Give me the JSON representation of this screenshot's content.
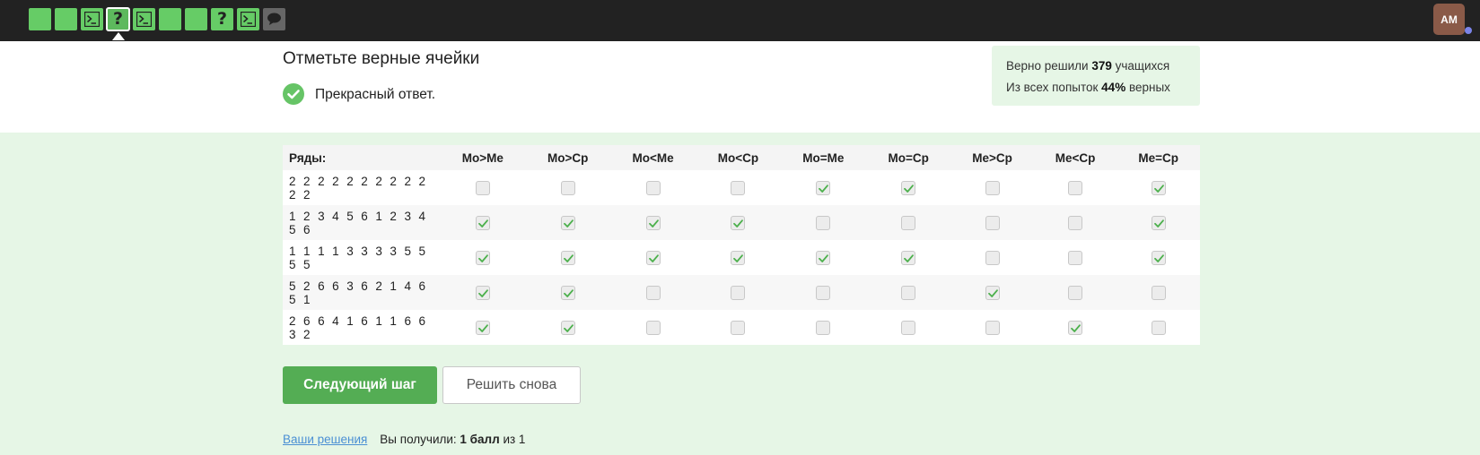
{
  "colors": {
    "accent": "#54ad54",
    "topbar": "#222222",
    "panel": "#e6f6e6",
    "link": "#4a8fd4"
  },
  "steps": [
    {
      "icon": "none",
      "state": "solved"
    },
    {
      "icon": "none",
      "state": "solved"
    },
    {
      "icon": "terminal-icon",
      "state": "solved"
    },
    {
      "icon": "question-icon",
      "glyph": "?",
      "state": "active"
    },
    {
      "icon": "terminal-icon",
      "state": "solved"
    },
    {
      "icon": "none",
      "state": "solved"
    },
    {
      "icon": "none",
      "state": "solved"
    },
    {
      "icon": "question-icon",
      "glyph": "?",
      "state": "solved"
    },
    {
      "icon": "terminal-icon",
      "state": "solved"
    },
    {
      "icon": "comment-icon",
      "state": "unsolved"
    }
  ],
  "user": {
    "initials": "АМ"
  },
  "task": {
    "title": "Отметьте верные ячейки",
    "feedback": "Прекрасный ответ."
  },
  "stats": {
    "solved_prefix": "Верно решили",
    "solved_count": "379",
    "solved_suffix": "учащихся",
    "attempts_prefix": "Из всех попыток",
    "attempts_percent": "44%",
    "attempts_suffix": "верных"
  },
  "table": {
    "rows_header": "Ряды:",
    "columns": [
      "Мо>Ме",
      "Мо>Ср",
      "Мо<Ме",
      "Мо<Ср",
      "Мо=Ме",
      "Мо=Ср",
      "Ме>Ср",
      "Ме<Ср",
      "Ме=Ср"
    ],
    "rows": [
      {
        "label": "2 2 2 2 2 2 2 2 2 2 2 2",
        "checked": [
          false,
          false,
          false,
          false,
          true,
          true,
          false,
          false,
          true
        ]
      },
      {
        "label": "1 2 3 4 5 6 1 2 3 4 5 6",
        "checked": [
          true,
          true,
          true,
          true,
          false,
          false,
          false,
          false,
          true
        ]
      },
      {
        "label": "1 1 1 1 3 3 3 3 5 5 5 5",
        "checked": [
          true,
          true,
          true,
          true,
          true,
          true,
          false,
          false,
          true
        ]
      },
      {
        "label": "5 2 6 6 3 6 2 1 4 6 5 1",
        "checked": [
          true,
          true,
          false,
          false,
          false,
          false,
          true,
          false,
          false
        ]
      },
      {
        "label": "2 6 6 4 1 6 1 1 6 6 3 2",
        "checked": [
          true,
          true,
          false,
          false,
          false,
          false,
          false,
          true,
          false
        ]
      }
    ]
  },
  "buttons": {
    "next": "Следующий шаг",
    "retry": "Решить снова"
  },
  "footer": {
    "solutions_link": "Ваши решения",
    "score_prefix": "Вы получили:",
    "score_value": "1 балл",
    "score_suffix": "из 1"
  }
}
